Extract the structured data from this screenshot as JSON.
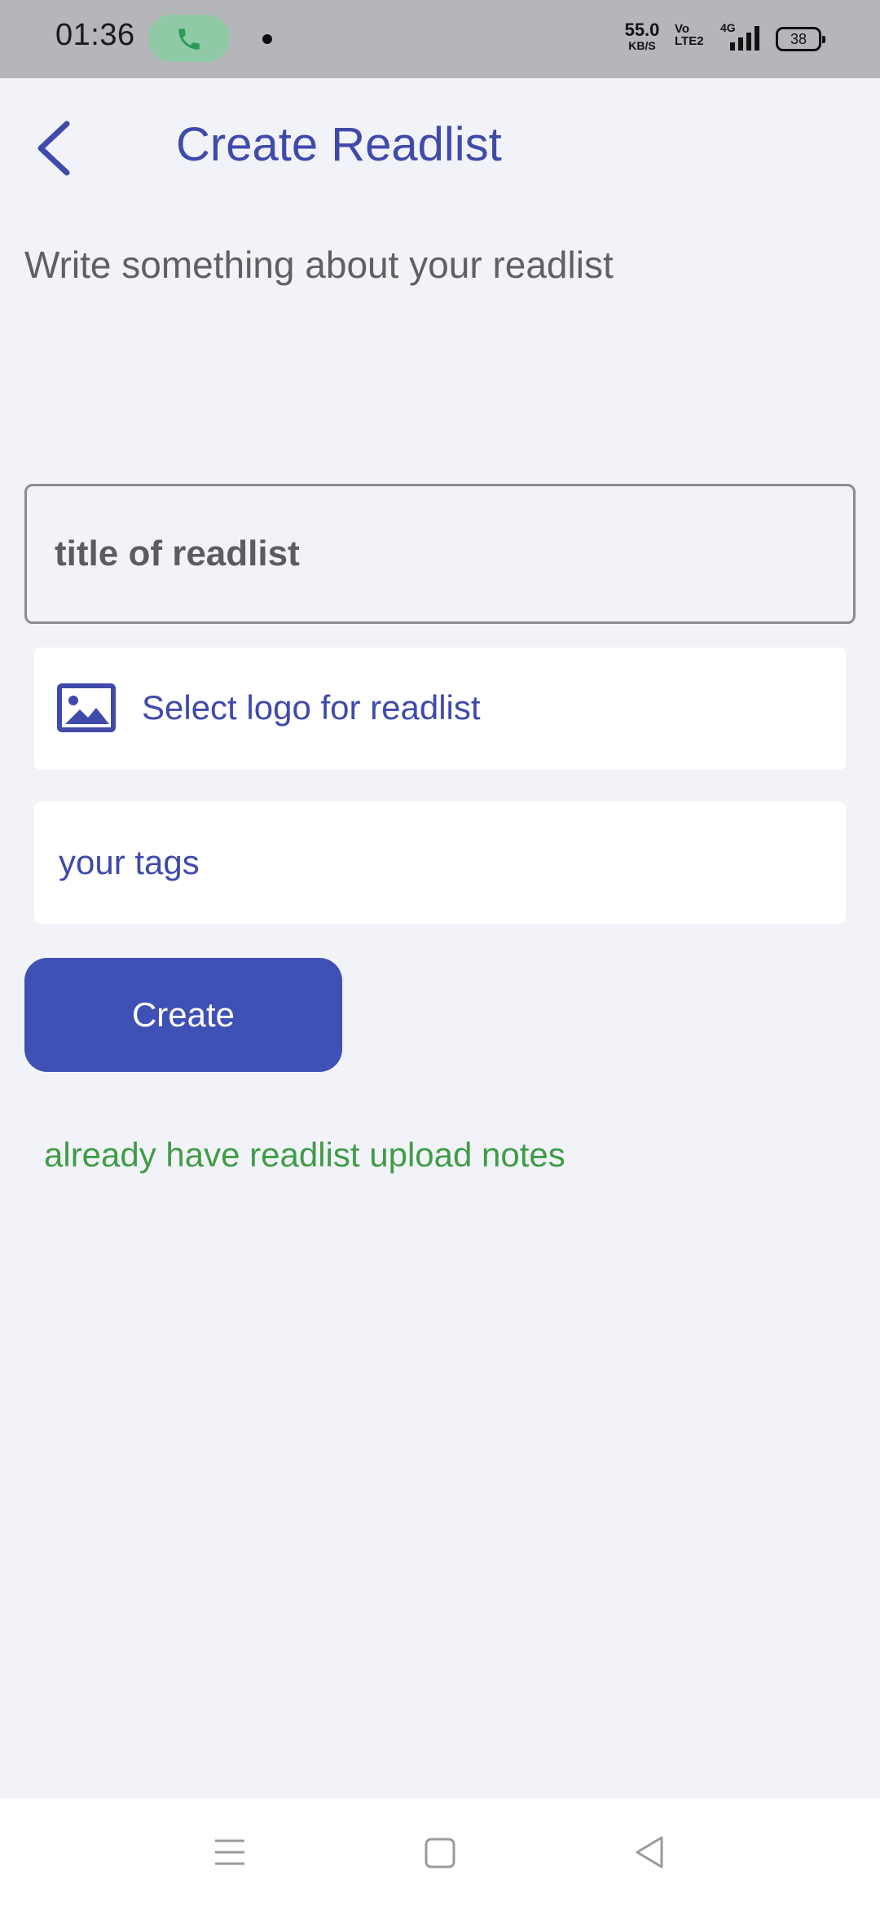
{
  "status_bar": {
    "time": "01:36",
    "net_speed_value": "55.0",
    "net_speed_unit": "KB/S",
    "volte_top": "Vo",
    "volte_bottom": "LTE2",
    "network_type": "4G",
    "battery_level": "38",
    "icons": [
      "phone-call-icon",
      "notification-dot",
      "signal-icon",
      "battery-icon"
    ],
    "call_pill_color": "#8fc9a5"
  },
  "header": {
    "title": "Create Readlist",
    "back_icon": "chevron-left-icon"
  },
  "form": {
    "description": "Write something about your readlist",
    "title_placeholder": "title of readlist",
    "logo_label": "Select logo for readlist",
    "logo_icon": "image-icon",
    "tags_placeholder": "your tags",
    "create_label": "Create",
    "upload_link": "already have readlist upload notes"
  },
  "nav_bar": {
    "icons": [
      "menu-icon",
      "home-square-icon",
      "back-triangle-icon"
    ]
  },
  "colors": {
    "accent": "#3f51b5",
    "title_text": "#3f4aab",
    "link_green": "#3f9c46",
    "background": "#f2f3f8"
  }
}
